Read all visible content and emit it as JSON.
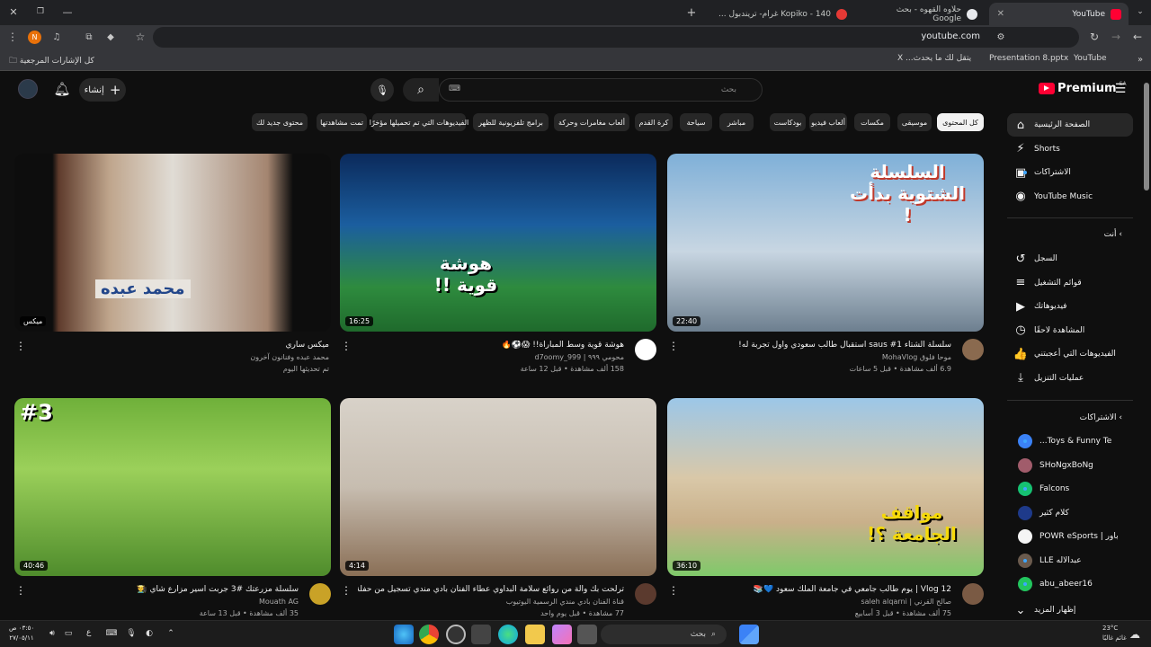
{
  "browser": {
    "tabs": [
      {
        "label": "YouTube",
        "active": true
      },
      {
        "label": "حلاوه القهوه - بحث Google",
        "active": false
      },
      {
        "label": "Kopiko - 140 غرام- تريندبول ...",
        "active": false
      }
    ],
    "url": "youtube.com",
    "profile_initial": "N",
    "bookmarks": {
      "all_bookmarks": "كل الإشارات المرجعية",
      "youtube": "YouTube",
      "presentation": "Presentation 8.pptx",
      "x_post": "يتقل لك ما يحدث... X"
    }
  },
  "header": {
    "logo": "Premium",
    "logo_sup": "SA",
    "search_placeholder": "بحث",
    "create_label": "إنشاء"
  },
  "chips": [
    "كل المحتوى",
    "موسيقى",
    "مكسات",
    "ألعاب فيديو",
    "بودكاست",
    "مباشر",
    "سياحة",
    "كرة القدم",
    "ألعاب مغامرات وحركة",
    "برامج تلفزيونية للظهر",
    "الفيديوهات التي تم تحميلها مؤخرًا",
    "تمت مشاهدتها",
    "محتوى جديد لك"
  ],
  "sidebar": {
    "main": [
      {
        "label": "الصفحة الرئيسية",
        "icon": "home-icon",
        "glyph": "⌂"
      },
      {
        "label": "Shorts",
        "icon": "shorts-icon",
        "glyph": "⚡"
      },
      {
        "label": "الاشتراكات",
        "icon": "subscriptions-icon",
        "glyph": "▣"
      },
      {
        "label": "YouTube Music",
        "icon": "music-icon",
        "glyph": "◉"
      }
    ],
    "you_header": "أنت",
    "you": [
      {
        "label": "السجل",
        "icon": "history-icon",
        "glyph": "↺"
      },
      {
        "label": "قوائم التشغيل",
        "icon": "playlist-icon",
        "glyph": "≡"
      },
      {
        "label": "فيديوهاتك",
        "icon": "your-videos-icon",
        "glyph": "▶"
      },
      {
        "label": "المشاهدة لاحقًا",
        "icon": "watch-later-icon",
        "glyph": "◷"
      },
      {
        "label": "الفيديوهات التي أعجبتني",
        "icon": "like-icon",
        "glyph": "👍"
      },
      {
        "label": "عمليات التنزيل",
        "icon": "download-icon",
        "glyph": "⤓"
      }
    ],
    "subs_header": "الاشتراكات",
    "subs": [
      {
        "label": "Toys & Funny Te...",
        "color": "#3b82f6"
      },
      {
        "label": "SHoNgxBoNg",
        "color": "#a15c6b"
      },
      {
        "label": "Falcons",
        "color": "#16c172"
      },
      {
        "label": "كلام كثير",
        "color": "#1e3a8a"
      },
      {
        "label": "باور | POWR eSports",
        "color": "#f5f5f5"
      },
      {
        "label": "عبدالاله LLE",
        "color": "#6b5b4e"
      },
      {
        "label": "abu_abeer16",
        "color": "#22c55e"
      }
    ],
    "show_more": "إظهار المزيد"
  },
  "videos": [
    {
      "title": "سلسلة الشتاء saus #1 استقبال طالب سعودي وأول تجربة له!",
      "channel": "موحا فلوق MohaVlog",
      "stats": "6.9 ألف مشاهدة • قبل 5 ساعات",
      "duration": "22:40",
      "overlay": "السلسلة الشتوية بدأت !",
      "av": "#8a6a4f"
    },
    {
      "title": "هوشة قوية وسط المباراة!! 😱⚽️🔥",
      "channel": "محومي ٩٩٩ | d7oomy_999",
      "stats": "158 ألف مشاهدة • قبل 12 ساعة",
      "duration": "16:25",
      "overlay": "هوشة قوية !!",
      "av": "#ffffff"
    },
    {
      "title": "ميكس ساري",
      "channel": "محمد عبده وفنانون آخرون",
      "stats": "تم تحديثها اليوم",
      "duration": "ميكس",
      "overlay": "محمد عبده",
      "av": ""
    },
    {
      "title": "Vlog 12 | يوم طالب جامعي في جامعة الملك سعود 💙📚",
      "channel": "صالح القرني | saleh alqarni",
      "stats": "75 ألف مشاهدة • قبل 3 أسابيع",
      "duration": "36:10",
      "overlay": "مواقف الجامعة ؟!",
      "av": "#7a5a44"
    },
    {
      "title": "ترلحت بك وآلة من روائع سلامة البداوي عطاء الفنان بادي مندي تسجيل من حفلة قديمة",
      "channel": "قناة الفنان بادي مندي الرسمية اليوتيوب",
      "stats": "77 مشاهدة • قبل يوم واحد",
      "duration": "4:14",
      "overlay": "",
      "av": "#5b3a2e"
    },
    {
      "title": "سلسلة مزرعتك #3 جربت اسير مزارع شاي 🧑‍🌾",
      "channel": "Mouath AG",
      "stats": "35 ألف مشاهدة • قبل 13 ساعة",
      "duration": "40:46",
      "overlay": "#3",
      "av": "#c9a227"
    }
  ],
  "taskbar": {
    "search": "بحث",
    "time": "٠٣:٥٠ ص",
    "date": "٢٧/٠٥/١١",
    "weather_temp": "23°C",
    "weather_desc": "غائم غالبًا",
    "lang": "ع"
  }
}
